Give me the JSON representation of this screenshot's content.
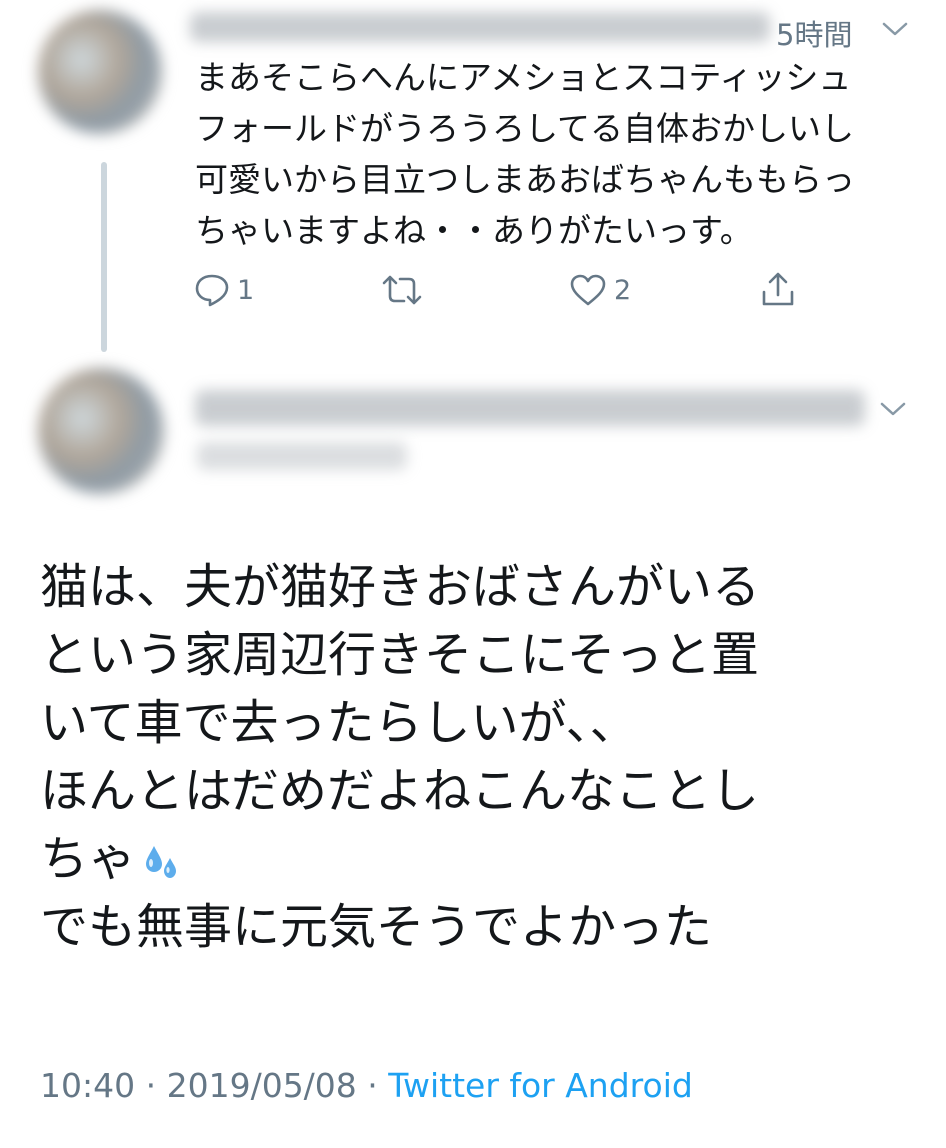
{
  "reply_tweet": {
    "time": "5時間",
    "lines": [
      "まあそこらへんにアメショとスコティッシュ",
      "フォールドがうろうろしてる自体おかしいし",
      "可愛いから目立つしまあおばちゃんももらっ",
      "ちゃいますよね・・ありがたいっす。"
    ],
    "reply_count": "1",
    "like_count": "2"
  },
  "main_tweet": {
    "lines": [
      "猫は、夫が猫好きおばさんがいる",
      "という家周辺行きそこにそっと置",
      "いて車で去ったらしいが、、",
      "ほんとはだめだよねこんなことし",
      "ちゃ",
      "でも無事に元気そうでよかった"
    ],
    "emoji": "sweat-droplets-emoji",
    "time": "10:40",
    "separator": " · ",
    "date": "2019/05/08",
    "source": "Twitter for Android"
  },
  "colors": {
    "text": "#14171a",
    "muted": "#657786",
    "link": "#1da1f2",
    "thread_line": "#ccd6dd"
  }
}
